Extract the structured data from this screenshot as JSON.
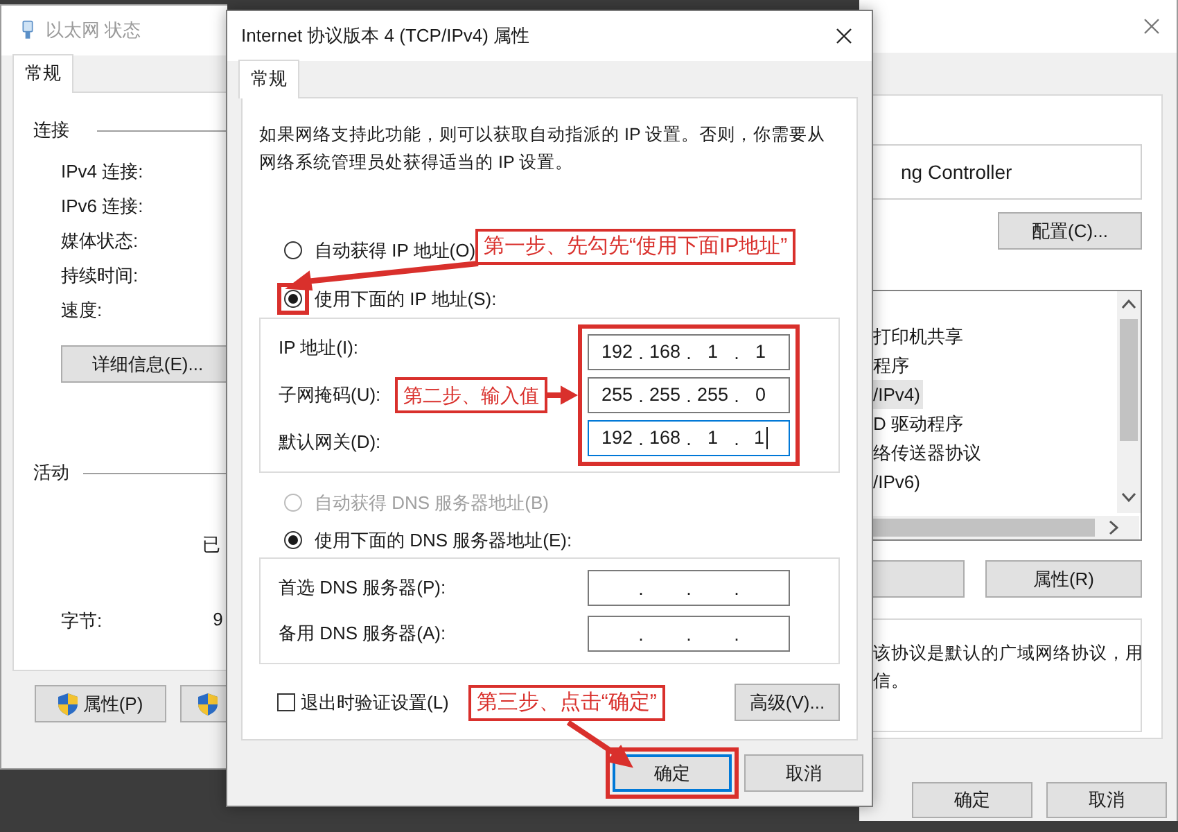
{
  "status_window": {
    "title": "以太网 状态",
    "tabs": [
      {
        "label": "常规",
        "selected": true
      }
    ],
    "connection": {
      "heading": "连接",
      "labels": [
        "IPv4 连接:",
        "IPv6 连接:",
        "媒体状态:",
        "持续时间:",
        "速度:"
      ],
      "details_button": "详细信息(E)..."
    },
    "activity": {
      "heading": "活动",
      "sent_header": "已",
      "bytes_label": "字节:",
      "bytes_sent": "9"
    },
    "buttons": [
      {
        "label": "属性(P)",
        "shield": true
      },
      {
        "shield": true
      }
    ]
  },
  "dialog": {
    "title": "Internet 协议版本 4 (TCP/IPv4) 属性",
    "tabs": [
      {
        "label": "常规",
        "selected": true
      }
    ],
    "description": "如果网络支持此功能，则可以获取自动指派的 IP 设置。否则，你需要从网络系统管理员处获得适当的 IP 设置。",
    "ip_mode": [
      {
        "label": "自动获得 IP 地址(O)",
        "selected": false,
        "disabled": false,
        "highlighted": false
      },
      {
        "label": "使用下面的 IP 地址(S):",
        "selected": true,
        "disabled": false,
        "highlighted": true
      }
    ],
    "ip_mode_callout": "第一步、先勾先“使用下面IP地址”",
    "ip_fields": [
      {
        "label": "IP 地址(I):",
        "octets": [
          "192",
          "168",
          "1",
          "1"
        ],
        "separator": ".",
        "focused": false
      },
      {
        "label": "子网掩码(U):",
        "octets": [
          "255",
          "255",
          "255",
          "0"
        ],
        "separator": ".",
        "focused": false
      },
      {
        "label": "默认网关(D):",
        "octets": [
          "192",
          "168",
          "1",
          "1"
        ],
        "separator": ".",
        "focused": true
      }
    ],
    "ip_fields_highlighted": true,
    "ip_fields_callout": "第二步、输入值",
    "dns_mode": [
      {
        "label": "自动获得 DNS 服务器地址(B)",
        "selected": false,
        "disabled": true
      },
      {
        "label": "使用下面的 DNS 服务器地址(E):",
        "selected": true,
        "disabled": false
      }
    ],
    "dns_fields": [
      {
        "label": "首选 DNS 服务器(P):",
        "separator": "."
      },
      {
        "label": "备用 DNS 服务器(A):",
        "separator": "."
      }
    ],
    "validate_on_exit": {
      "label": "退出时验证设置(L)",
      "checked": false
    },
    "ok_callout": "第三步、点击“确定”",
    "advanced_button": "高级(V)...",
    "ok_button": {
      "label": "确定",
      "focused": true,
      "highlighted": true
    },
    "cancel_button": "取消"
  },
  "properties_window": {
    "adapter_name": "ng Controller",
    "configure_button": "配置(C)...",
    "components": [
      {
        "text": "打印机共享",
        "selected": false
      },
      {
        "text": "程序",
        "selected": false
      },
      {
        "text": "/IPv4)",
        "selected": true
      },
      {
        "text": "D 驱动程序",
        "selected": false
      },
      {
        "text": "络传送器协议",
        "selected": false
      },
      {
        "text": "/IPv6)",
        "selected": false
      }
    ],
    "properties_button": "属性(R)",
    "description_lines": [
      "该协议是默认的广域网络协议，用",
      "信。"
    ],
    "footer_buttons": [
      "确定",
      "取消"
    ]
  }
}
